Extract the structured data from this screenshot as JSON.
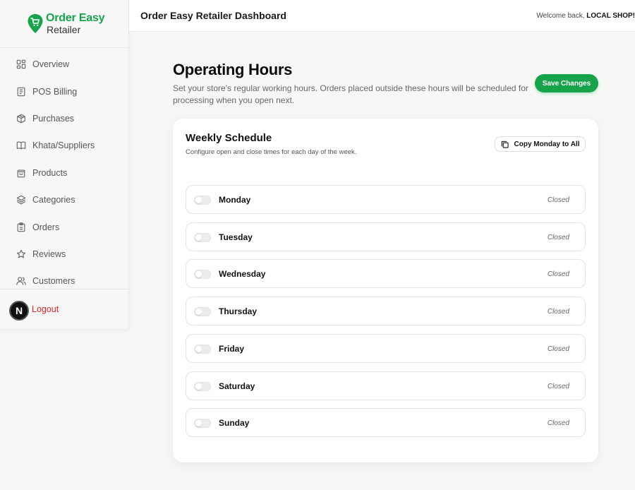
{
  "brand": {
    "line1": "Order Easy",
    "line2": "Retailer",
    "color": "#16a34a"
  },
  "sidebar": {
    "items": [
      {
        "label": "Overview",
        "icon": "dashboard-icon"
      },
      {
        "label": "POS Billing",
        "icon": "receipt-icon"
      },
      {
        "label": "Purchases",
        "icon": "package-icon"
      },
      {
        "label": "Khata/Suppliers",
        "icon": "book-icon"
      },
      {
        "label": "Products",
        "icon": "shopping-bag-icon"
      },
      {
        "label": "Categories",
        "icon": "layers-icon"
      },
      {
        "label": "Orders",
        "icon": "clipboard-icon"
      },
      {
        "label": "Reviews",
        "icon": "star-icon"
      },
      {
        "label": "Customers",
        "icon": "users-icon"
      }
    ],
    "logout_label": "Logout",
    "avatar_letter": "N"
  },
  "header": {
    "title": "Order Easy Retailer Dashboard",
    "welcome_prefix": "Welcome back, ",
    "shop_name": "LOCAL SHOP!"
  },
  "main": {
    "title": "Operating Hours",
    "description": "Set your store's regular working hours. Orders placed outside these hours will be scheduled for processing when you open next.",
    "save_label": "Save Changes"
  },
  "schedule": {
    "title": "Weekly Schedule",
    "subtitle": "Configure open and close times for each day of the week.",
    "copy_label": "Copy Monday to All",
    "days": [
      {
        "name": "Monday",
        "status": "Closed"
      },
      {
        "name": "Tuesday",
        "status": "Closed"
      },
      {
        "name": "Wednesday",
        "status": "Closed"
      },
      {
        "name": "Thursday",
        "status": "Closed"
      },
      {
        "name": "Friday",
        "status": "Closed"
      },
      {
        "name": "Saturday",
        "status": "Closed"
      },
      {
        "name": "Sunday",
        "status": "Closed"
      }
    ]
  }
}
